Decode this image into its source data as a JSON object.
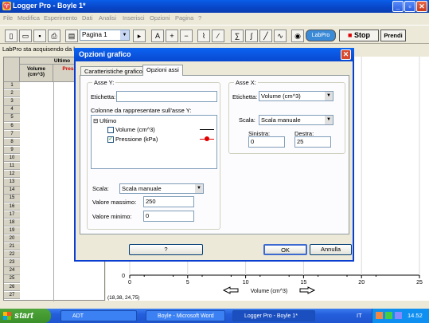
{
  "app": {
    "title": "Logger Pro - Boyle 1*",
    "menu": [
      "File",
      "Modifica",
      "Esperimento",
      "Dati",
      "Analisi",
      "Inserisci",
      "Opzioni",
      "Pagina",
      "?"
    ],
    "page_select": "Pagina 1",
    "labpro_label": "LabPro",
    "stop_label": "Stop",
    "prendi_label": "Prendi",
    "status_text": "LabPro sta acquisendo da l"
  },
  "table": {
    "group": "Ultimo",
    "col1": "Volume (cm^3)",
    "col2": "Pressio (kPa)",
    "rows": [
      "1",
      "2",
      "3",
      "4",
      "5",
      "6",
      "7",
      "8",
      "9",
      "10",
      "11",
      "12",
      "13",
      "14",
      "15",
      "16",
      "17",
      "18",
      "19",
      "20",
      "21",
      "22",
      "23",
      "24",
      "25",
      "26",
      "27"
    ]
  },
  "graph": {
    "x_ticks": [
      "0",
      "5",
      "10",
      "15",
      "20",
      "25"
    ],
    "xlabel": "Volume (cm^3)",
    "y_tick_zero": "0",
    "coords": "(18,38, 24,75)"
  },
  "dialog": {
    "title": "Opzioni grafico",
    "tabs": [
      "Caratteristiche grafico",
      "Opzioni assi"
    ],
    "y_axis": {
      "group": "Asse Y:",
      "label_caption": "Etichetta:",
      "label_value": "",
      "columns_caption": "Colonne da rappresentare sull'asse Y:",
      "tree_root": "Ultimo",
      "items": [
        {
          "label": "Volume (cm^3)",
          "checked": false,
          "color": "#000000"
        },
        {
          "label": "Pressione (kPa)",
          "checked": true,
          "color": "#e00000"
        }
      ],
      "scale_caption": "Scala:",
      "scale_value": "Scala manuale",
      "max_caption": "Valore massimo:",
      "max_value": "250",
      "min_caption": "Valore minimo:",
      "min_value": "0"
    },
    "x_axis": {
      "group": "Asse X:",
      "label_caption": "Etichetta:",
      "label_value": "Volume (cm^3)",
      "scale_caption": "Scala:",
      "scale_value": "Scala manuale",
      "left_caption": "Sinistra:",
      "left_value": "0",
      "right_caption": "Destra:",
      "right_value": "25"
    },
    "help_label": "?",
    "ok_label": "OK",
    "cancel_label": "Annulla"
  },
  "taskbar": {
    "start_label": "start",
    "tasks": [
      "ADT",
      "Boyle - Microsoft Word",
      "Logger Pro - Boyle 1*"
    ],
    "lang": "IT",
    "clock": "14.52"
  }
}
